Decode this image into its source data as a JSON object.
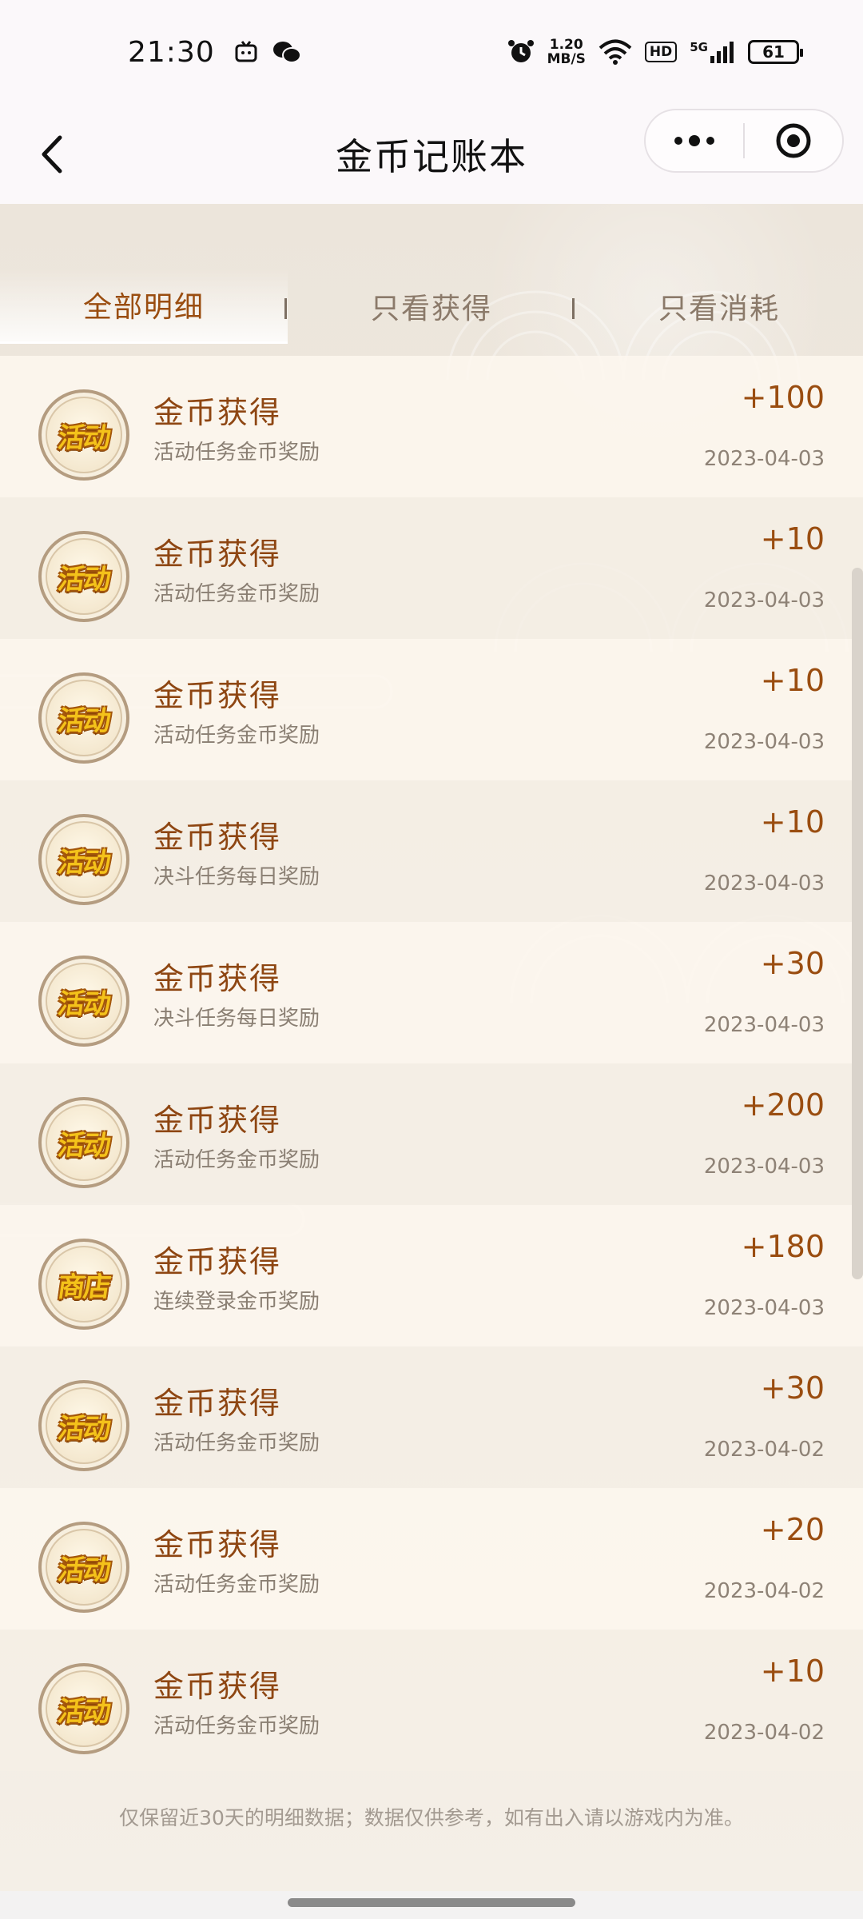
{
  "status_bar": {
    "time": "21:30",
    "net_speed_value": "1.20",
    "net_speed_unit": "MB/S",
    "hd": "HD",
    "network": "5G",
    "battery": "61"
  },
  "nav": {
    "title": "金币记账本"
  },
  "tabs": [
    {
      "label": "全部明细",
      "active": true
    },
    {
      "label": "只看获得",
      "active": false
    },
    {
      "label": "只看消耗",
      "active": false
    }
  ],
  "records": [
    {
      "badge": "活动",
      "title": "金币获得",
      "desc": "活动任务金币奖励",
      "amount": "+100",
      "date": "2023-04-03"
    },
    {
      "badge": "活动",
      "title": "金币获得",
      "desc": "活动任务金币奖励",
      "amount": "+10",
      "date": "2023-04-03"
    },
    {
      "badge": "活动",
      "title": "金币获得",
      "desc": "活动任务金币奖励",
      "amount": "+10",
      "date": "2023-04-03"
    },
    {
      "badge": "活动",
      "title": "金币获得",
      "desc": "决斗任务每日奖励",
      "amount": "+10",
      "date": "2023-04-03"
    },
    {
      "badge": "活动",
      "title": "金币获得",
      "desc": "决斗任务每日奖励",
      "amount": "+30",
      "date": "2023-04-03"
    },
    {
      "badge": "活动",
      "title": "金币获得",
      "desc": "活动任务金币奖励",
      "amount": "+200",
      "date": "2023-04-03"
    },
    {
      "badge": "商店",
      "title": "金币获得",
      "desc": "连续登录金币奖励",
      "amount": "+180",
      "date": "2023-04-03"
    },
    {
      "badge": "活动",
      "title": "金币获得",
      "desc": "活动任务金币奖励",
      "amount": "+30",
      "date": "2023-04-02"
    },
    {
      "badge": "活动",
      "title": "金币获得",
      "desc": "活动任务金币奖励",
      "amount": "+20",
      "date": "2023-04-02"
    },
    {
      "badge": "活动",
      "title": "金币获得",
      "desc": "活动任务金币奖励",
      "amount": "+10",
      "date": "2023-04-02"
    }
  ],
  "footer_note": "仅保留近30天的明细数据；数据仅供参考，如有出入请以游戏内为准。",
  "colors": {
    "accent": "#9a4d10",
    "badge_text": "#f4c21a",
    "background": "#f3eee6"
  },
  "icons": {
    "back": "chevron-left-icon",
    "more": "more-dots-icon",
    "close": "target-close-icon"
  }
}
